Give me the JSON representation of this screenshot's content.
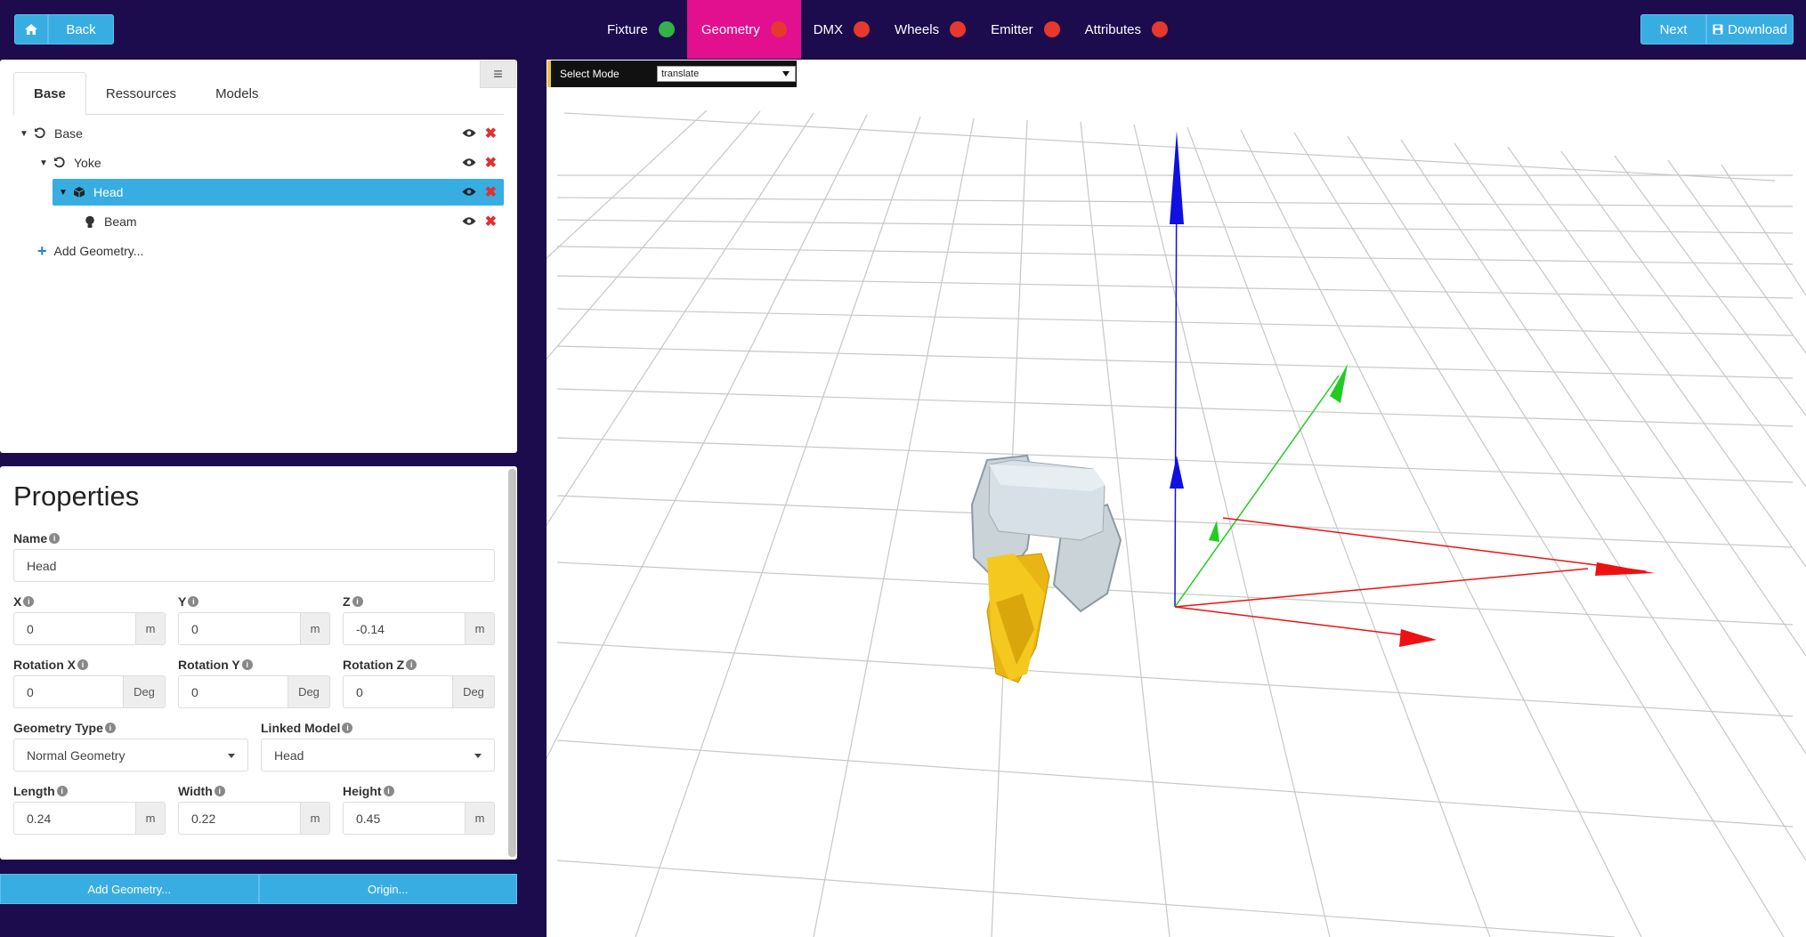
{
  "topbar": {
    "back_label": "Back",
    "next_label": "Next",
    "download_label": "Download",
    "tabs": [
      {
        "label": "Fixture",
        "status": "#33b249"
      },
      {
        "label": "Geometry",
        "status": "#e8372c"
      },
      {
        "label": "DMX",
        "status": "#e8372c"
      },
      {
        "label": "Wheels",
        "status": "#e8372c"
      },
      {
        "label": "Emitter",
        "status": "#e8372c"
      },
      {
        "label": "Attributes",
        "status": "#e8372c"
      }
    ],
    "active_tab": "Geometry"
  },
  "tree_panel": {
    "tabs": [
      "Base",
      "Ressources",
      "Models"
    ],
    "active_tab": "Base",
    "nodes": [
      {
        "label": "Base",
        "icon": "rotate-icon"
      },
      {
        "label": "Yoke",
        "icon": "rotate-icon"
      },
      {
        "label": "Head",
        "icon": "cube-icon",
        "selected": true
      },
      {
        "label": "Beam",
        "icon": "bulb-icon"
      }
    ],
    "add_label": "Add Geometry..."
  },
  "properties": {
    "title": "Properties",
    "name_label": "Name",
    "name_value": "Head",
    "x_label": "X",
    "x_value": "0",
    "x_unit": "m",
    "y_label": "Y",
    "y_value": "0",
    "y_unit": "m",
    "z_label": "Z",
    "z_value": "-0.14",
    "z_unit": "m",
    "rx_label": "Rotation X",
    "rx_value": "0",
    "rx_unit": "Deg",
    "ry_label": "Rotation Y",
    "ry_value": "0",
    "ry_unit": "Deg",
    "rz_label": "Rotation Z",
    "rz_value": "0",
    "rz_unit": "Deg",
    "geom_type_label": "Geometry Type",
    "geom_type_value": "Normal Geometry",
    "linked_model_label": "Linked Model",
    "linked_model_value": "Head",
    "length_label": "Length",
    "length_value": "0.24",
    "length_unit": "m",
    "width_label": "Width",
    "width_value": "0.22",
    "width_unit": "m",
    "height_label": "Height",
    "height_value": "0.45",
    "height_unit": "m"
  },
  "bottom_buttons": {
    "add_label": "Add Geometry...",
    "origin_label": "Origin..."
  },
  "viewport": {
    "mode_label": "Select Mode",
    "mode_value": "translate"
  }
}
